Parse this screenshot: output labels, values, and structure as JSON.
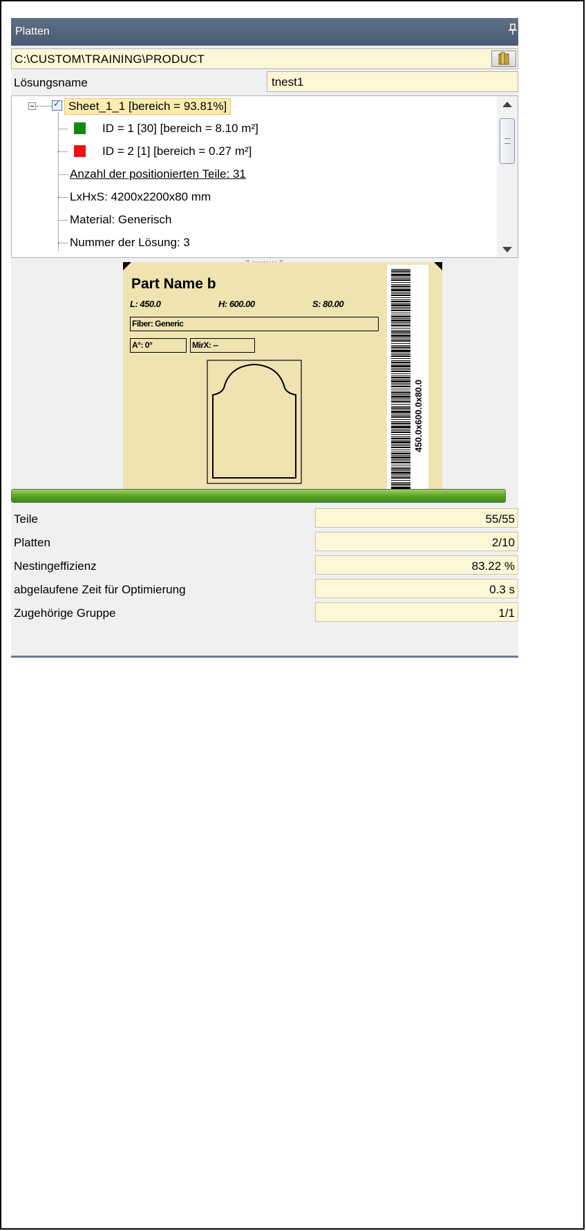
{
  "panel": {
    "title": "Platten",
    "path": "C:\\CUSTOM\\TRAINING\\PRODUCT",
    "solution_name_label": "Lösungsname",
    "solution_name_value": "tnest1"
  },
  "tree": {
    "sheet": "Sheet_1_1 [bereich = 93.81%]",
    "items": [
      {
        "label": "ID = 1 [30] [bereich = 8.10 m²]",
        "color": "#118a11"
      },
      {
        "label": "ID = 2 [1] [bereich = 0.27 m²]",
        "color": "#ee1111"
      },
      {
        "label": "Anzahl der positionierten Teile: 31"
      },
      {
        "label": "LxHxS: 4200x2200x80  mm"
      },
      {
        "label": "Material: Generisch"
      },
      {
        "label": "Nummer der Lösung: 3"
      }
    ]
  },
  "label_preview": {
    "part_name": "Part Name b",
    "l": "L: 450.0",
    "h": "H: 600.00",
    "s": "S: 80.00",
    "fiber": "Fiber: Generic",
    "angle": "A°: 0°",
    "mirror": "MirX: --",
    "barcode_text": "450.0x600.0x80.0"
  },
  "progress": {
    "value": 1.0
  },
  "stats": [
    {
      "label": "Teile",
      "value": "55/55"
    },
    {
      "label": "Platten",
      "value": "2/10"
    },
    {
      "label": "Nestingeffizienz",
      "value": "83.22 %"
    },
    {
      "label": "abgelaufene Zeit für Optimierung",
      "value": "0.3 s"
    },
    {
      "label": "Zugehörige Gruppe",
      "value": "1/1"
    }
  ]
}
